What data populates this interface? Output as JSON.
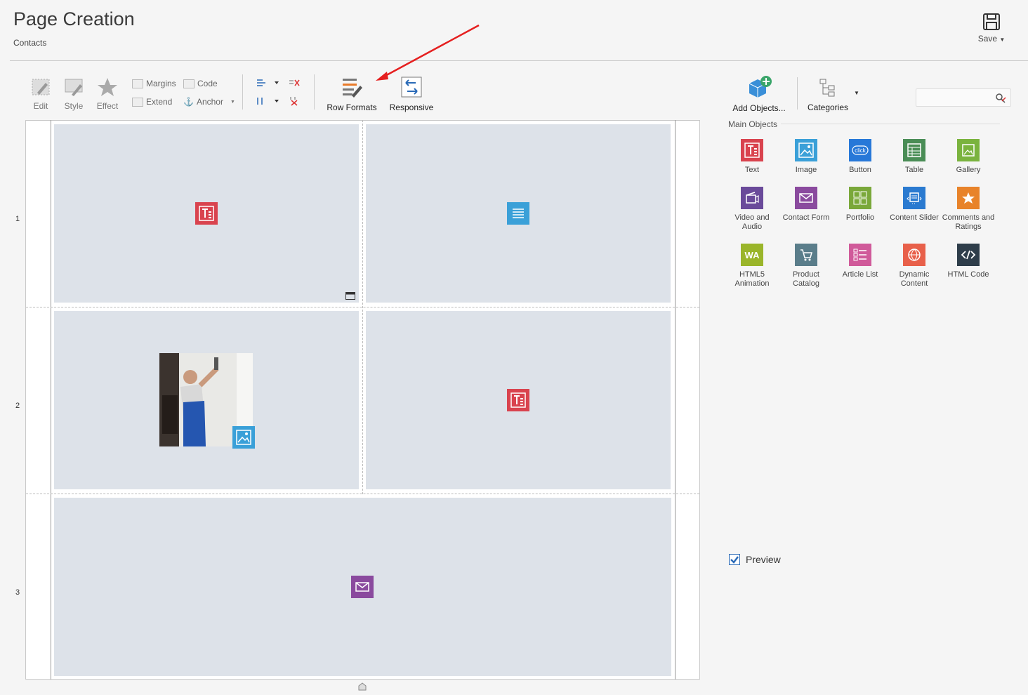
{
  "header": {
    "title": "Page Creation",
    "subtitle": "Contacts",
    "save_label": "Save"
  },
  "toolbar": {
    "edit": "Edit",
    "style": "Style",
    "effect": "Effect",
    "margins": "Margins",
    "code": "Code",
    "extend": "Extend",
    "anchor": "Anchor",
    "row_formats": "Row Formats",
    "responsive": "Responsive",
    "add_objects": "Add Objects...",
    "categories": "Categories"
  },
  "canvas": {
    "rows": [
      "1",
      "2",
      "3"
    ]
  },
  "right_panel": {
    "section_title": "Main Objects",
    "objects": [
      {
        "label": "Text",
        "icon": "text-icon",
        "color": "#d9434e"
      },
      {
        "label": "Image",
        "icon": "image-icon",
        "color": "#3aa0d8"
      },
      {
        "label": "Button",
        "icon": "button-icon",
        "color": "#2778d8"
      },
      {
        "label": "Table",
        "icon": "table-icon",
        "color": "#4a8d56"
      },
      {
        "label": "Gallery",
        "icon": "gallery-icon",
        "color": "#7ab33e"
      },
      {
        "label": "Video and Audio",
        "icon": "video-audio-icon",
        "color": "#6a4a9a"
      },
      {
        "label": "Contact Form",
        "icon": "contact-form-icon",
        "color": "#8a4a9e"
      },
      {
        "label": "Portfolio",
        "icon": "portfolio-icon",
        "color": "#7aa83a"
      },
      {
        "label": "Content Slider",
        "icon": "content-slider-icon",
        "color": "#2a7ad0"
      },
      {
        "label": "Comments and Ratings",
        "icon": "comments-ratings-icon",
        "color": "#e8832a"
      },
      {
        "label": "HTML5 Animation",
        "icon": "html5-animation-icon",
        "color": "#9ab52a"
      },
      {
        "label": "Product Catalog",
        "icon": "product-catalog-icon",
        "color": "#5a7d8a"
      },
      {
        "label": "Article List",
        "icon": "article-list-icon",
        "color": "#d05a9a"
      },
      {
        "label": "Dynamic Content",
        "icon": "dynamic-content-icon",
        "color": "#e8604a"
      },
      {
        "label": "HTML Code",
        "icon": "html-code-icon",
        "color": "#2e3d4a"
      }
    ],
    "preview_label": "Preview",
    "preview_checked": true
  }
}
